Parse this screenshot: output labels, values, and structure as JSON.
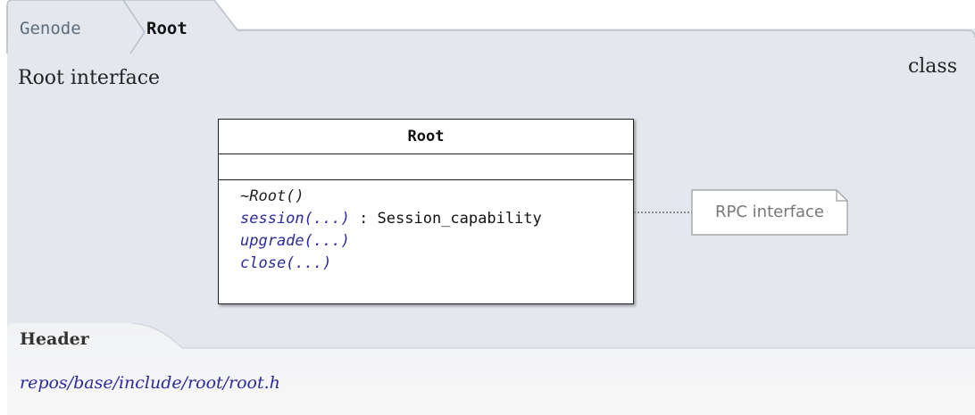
{
  "breadcrumb": {
    "items": [
      {
        "label": "Genode"
      },
      {
        "label": "Root"
      }
    ]
  },
  "page": {
    "title": "Root interface",
    "kind": "class"
  },
  "uml": {
    "class_name": "Root",
    "operations": [
      {
        "name": "~Root()",
        "return": ""
      },
      {
        "name": "session(...)",
        "return": " : Session_capability"
      },
      {
        "name": "upgrade(...)",
        "return": ""
      },
      {
        "name": "close(...)",
        "return": ""
      }
    ],
    "note": "RPC interface"
  },
  "header_section": {
    "title": "Header",
    "path": "repos/base/include/root/root.h"
  },
  "colors": {
    "panel": "#e4e8ee",
    "tab_fill": "#e4e8ee",
    "link": "#2a2a9a"
  }
}
